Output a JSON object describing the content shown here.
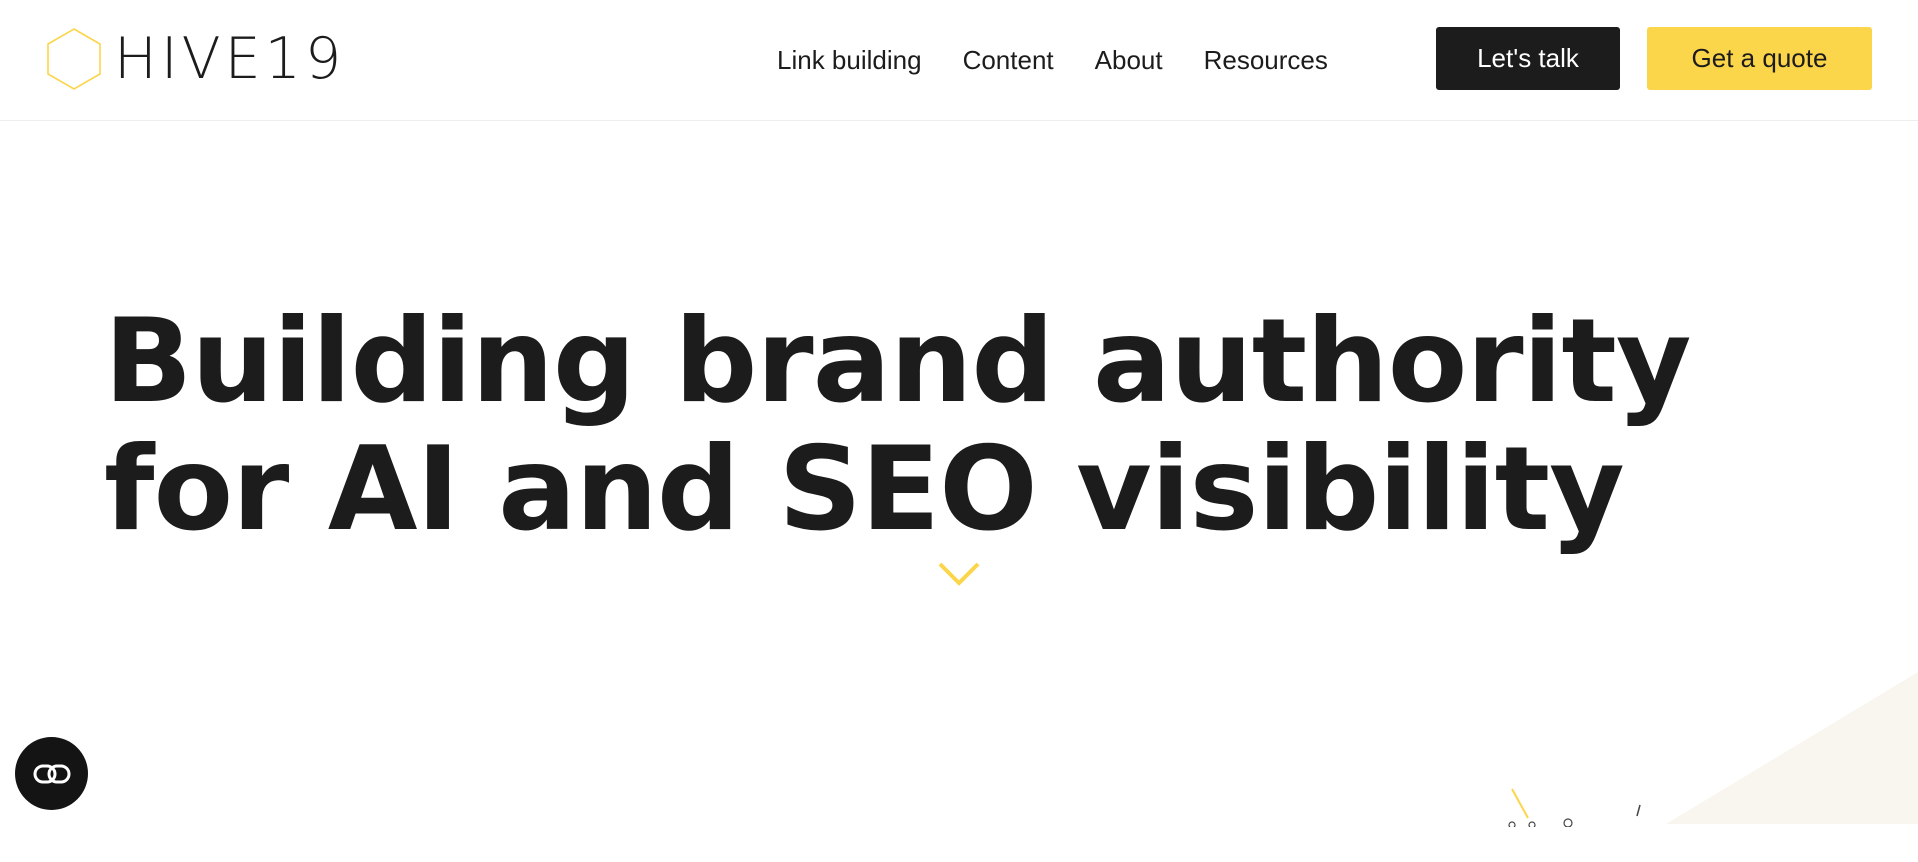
{
  "header": {
    "logo_text": "HIVE19",
    "nav": [
      {
        "label": "Link building"
      },
      {
        "label": "Content"
      },
      {
        "label": "About"
      },
      {
        "label": "Resources"
      }
    ],
    "talk_label": "Let's talk",
    "quote_label": "Get a quote"
  },
  "hero": {
    "line1": "Building brand authority",
    "line2": "for AI and SEO visibility"
  },
  "colors": {
    "accent": "#fbd54a",
    "text": "#1c1c1c",
    "dark_button": "#1c1c1c",
    "deco_shape": "#f9f6ef"
  },
  "icons": {
    "logo": "hexagon-icon",
    "scroll": "chevron-down-icon",
    "chat": "chat-link-icon"
  }
}
